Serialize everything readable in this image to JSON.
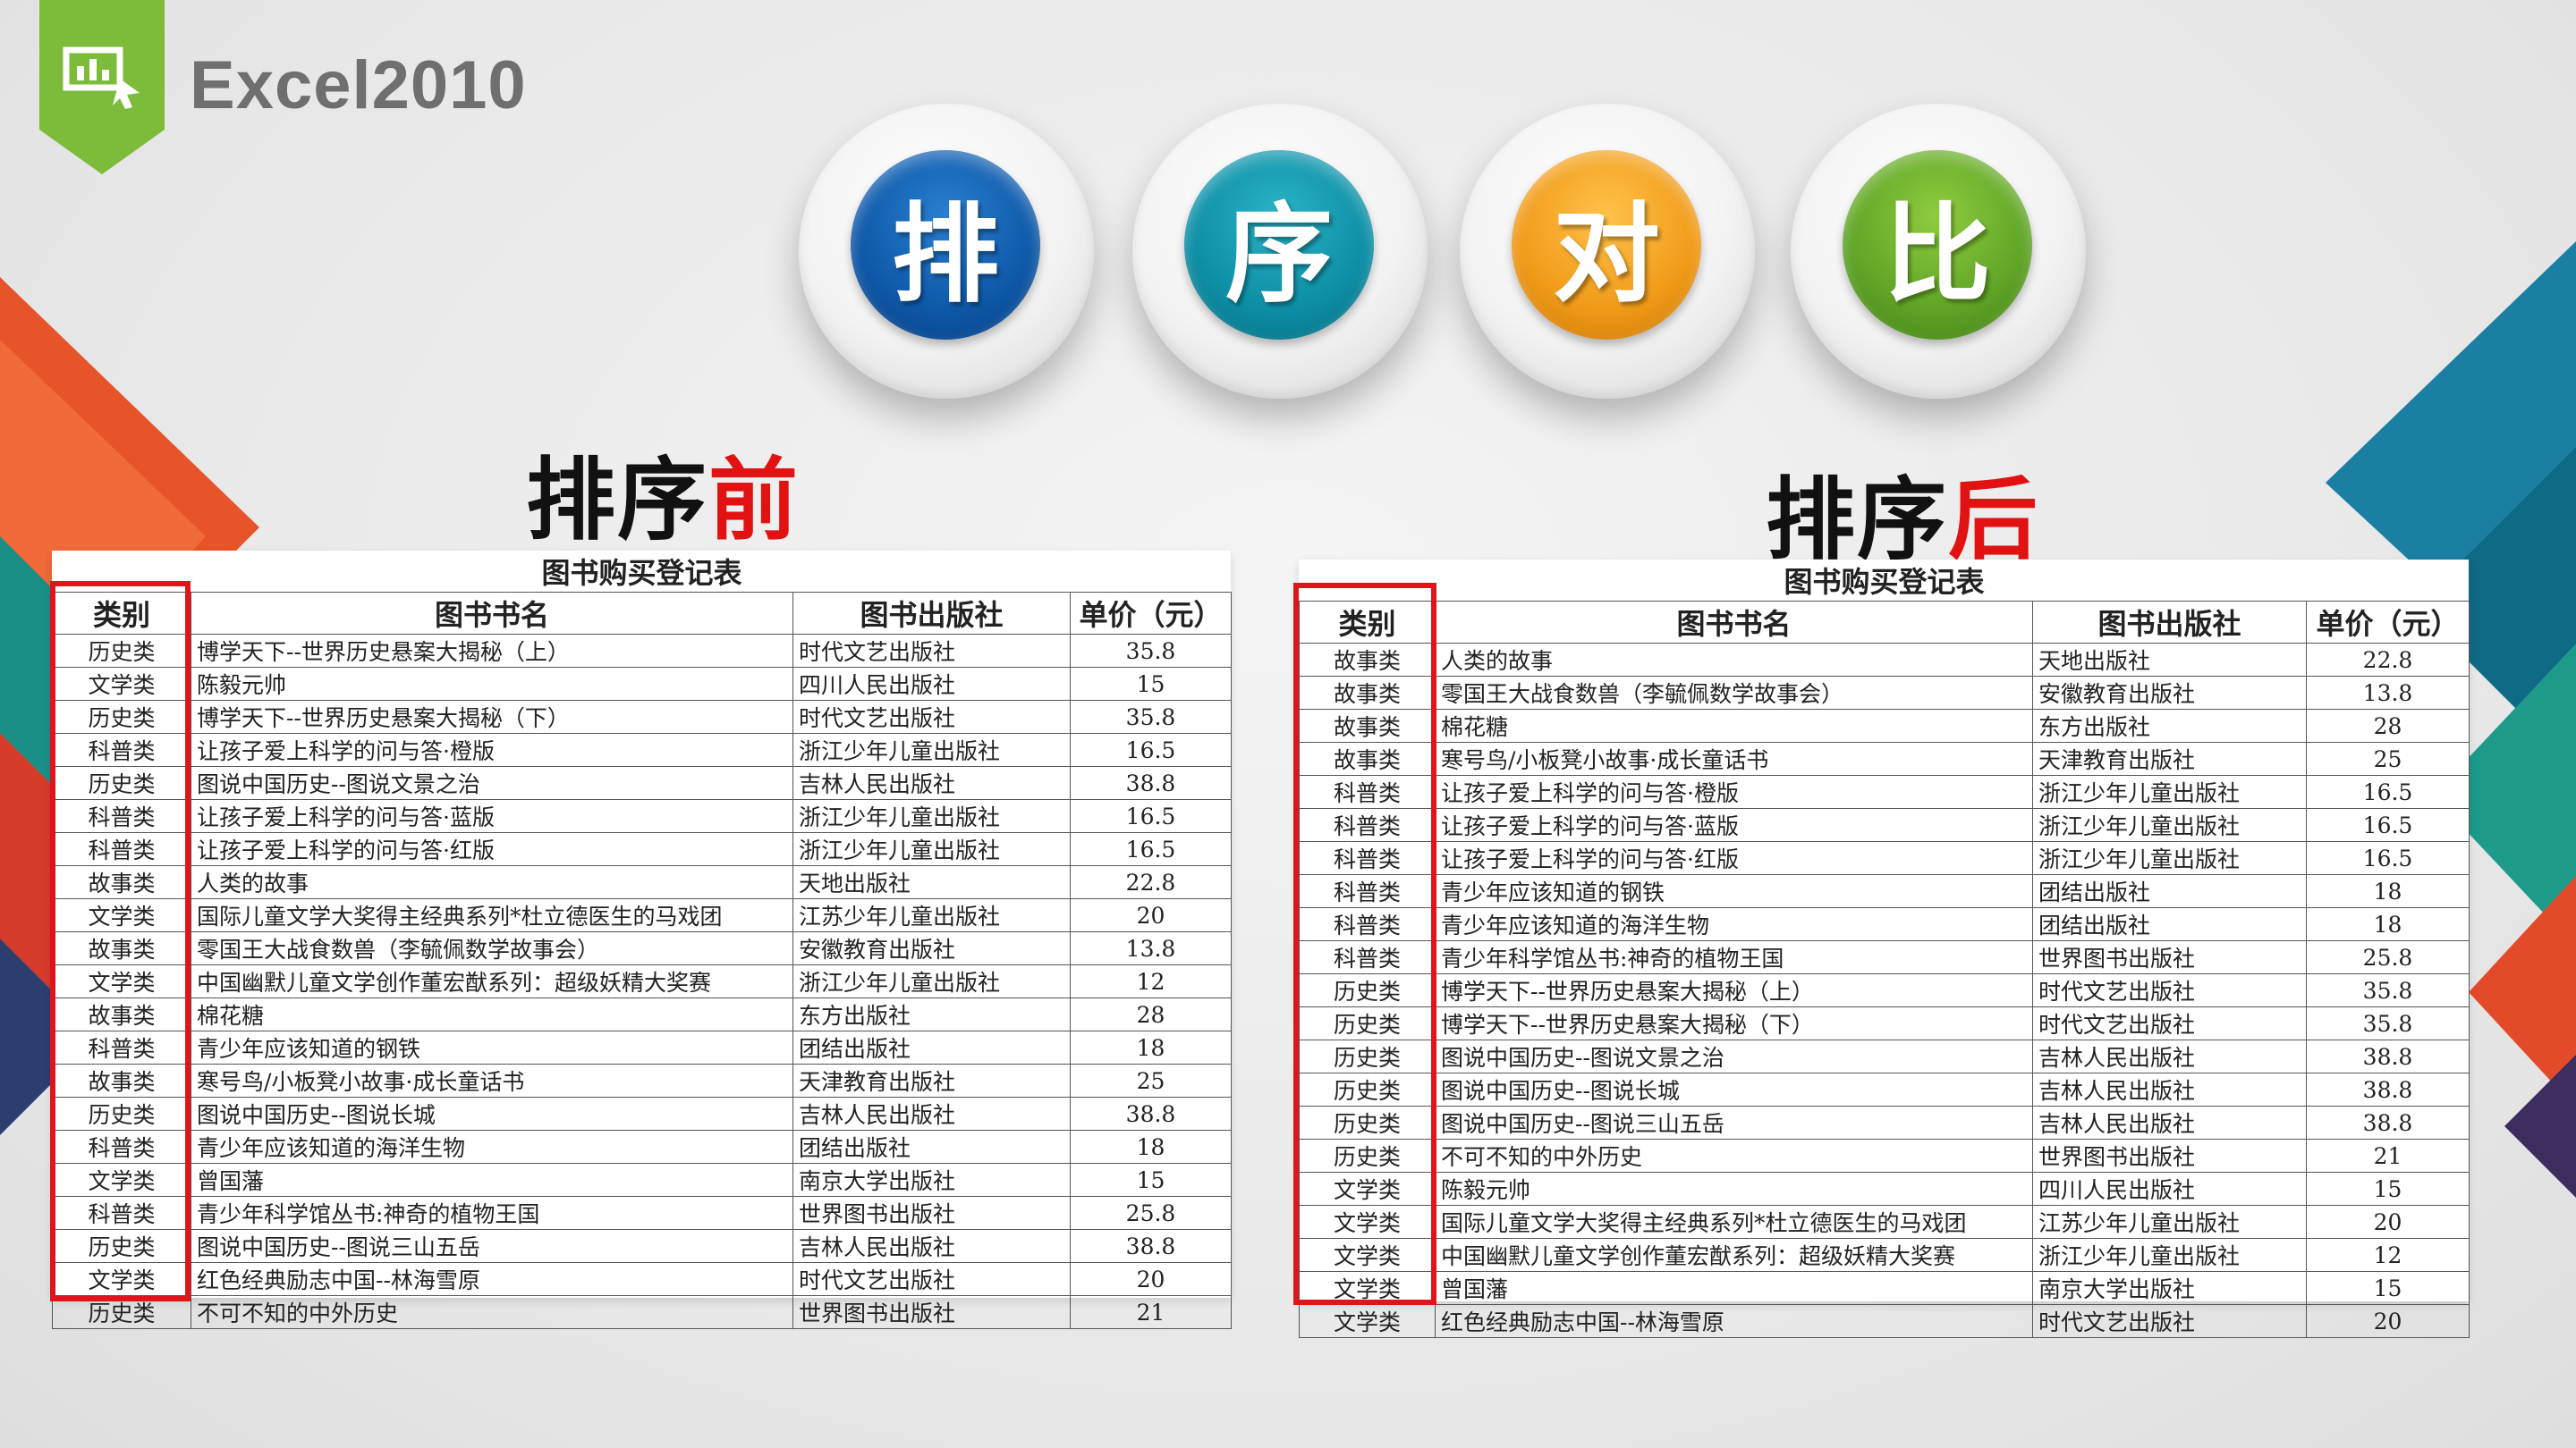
{
  "app": {
    "title": "Excel2010",
    "icon": "chart-icon"
  },
  "circles": [
    {
      "char": "排",
      "color": "#0e58a8"
    },
    {
      "char": "序",
      "color": "#0d8ea5"
    },
    {
      "char": "对",
      "color": "#f09a18"
    },
    {
      "char": "比",
      "color": "#5fa426"
    }
  ],
  "before": {
    "heading_main": "排序",
    "heading_accent": "前",
    "table_title": "图书购买登记表",
    "headers": [
      "类别",
      "图书书名",
      "图书出版社",
      "单价（元）"
    ],
    "rows": [
      [
        "历史类",
        "博学天下--世界历史悬案大揭秘（上）",
        "时代文艺出版社",
        "35.8"
      ],
      [
        "文学类",
        "陈毅元帅",
        "四川人民出版社",
        "15"
      ],
      [
        "历史类",
        "博学天下--世界历史悬案大揭秘（下）",
        "时代文艺出版社",
        "35.8"
      ],
      [
        "科普类",
        "让孩子爱上科学的问与答·橙版",
        "浙江少年儿童出版社",
        "16.5"
      ],
      [
        "历史类",
        "图说中国历史--图说文景之治",
        "吉林人民出版社",
        "38.8"
      ],
      [
        "科普类",
        "让孩子爱上科学的问与答·蓝版",
        "浙江少年儿童出版社",
        "16.5"
      ],
      [
        "科普类",
        "让孩子爱上科学的问与答·红版",
        "浙江少年儿童出版社",
        "16.5"
      ],
      [
        "故事类",
        "人类的故事",
        "天地出版社",
        "22.8"
      ],
      [
        "文学类",
        "国际儿童文学大奖得主经典系列*杜立德医生的马戏团",
        "江苏少年儿童出版社",
        "20"
      ],
      [
        "故事类",
        "零国王大战食数兽（李毓佩数学故事会）",
        "安徽教育出版社",
        "13.8"
      ],
      [
        "文学类",
        "中国幽默儿童文学创作董宏猷系列：超级妖精大奖赛",
        "浙江少年儿童出版社",
        "12"
      ],
      [
        "故事类",
        "棉花糖",
        "东方出版社",
        "28"
      ],
      [
        "科普类",
        "青少年应该知道的钢铁",
        "团结出版社",
        "18"
      ],
      [
        "故事类",
        "寒号鸟/小板凳小故事·成长童话书",
        "天津教育出版社",
        "25"
      ],
      [
        "历史类",
        "图说中国历史--图说长城",
        "吉林人民出版社",
        "38.8"
      ],
      [
        "科普类",
        "青少年应该知道的海洋生物",
        "团结出版社",
        "18"
      ],
      [
        "文学类",
        "曾国藩",
        "南京大学出版社",
        "15"
      ],
      [
        "科普类",
        "青少年科学馆丛书:神奇的植物王国",
        "世界图书出版社",
        "25.8"
      ],
      [
        "历史类",
        "图说中国历史--图说三山五岳",
        "吉林人民出版社",
        "38.8"
      ],
      [
        "文学类",
        "红色经典励志中国--林海雪原",
        "时代文艺出版社",
        "20"
      ],
      [
        "历史类",
        "不可不知的中外历史",
        "世界图书出版社",
        "21"
      ]
    ]
  },
  "after": {
    "heading_main": "排序",
    "heading_accent": "后",
    "table_title": "图书购买登记表",
    "headers": [
      "类别",
      "图书书名",
      "图书出版社",
      "单价（元）"
    ],
    "rows": [
      [
        "故事类",
        "人类的故事",
        "天地出版社",
        "22.8"
      ],
      [
        "故事类",
        "零国王大战食数兽（李毓佩数学故事会）",
        "安徽教育出版社",
        "13.8"
      ],
      [
        "故事类",
        "棉花糖",
        "东方出版社",
        "28"
      ],
      [
        "故事类",
        "寒号鸟/小板凳小故事·成长童话书",
        "天津教育出版社",
        "25"
      ],
      [
        "科普类",
        "让孩子爱上科学的问与答·橙版",
        "浙江少年儿童出版社",
        "16.5"
      ],
      [
        "科普类",
        "让孩子爱上科学的问与答·蓝版",
        "浙江少年儿童出版社",
        "16.5"
      ],
      [
        "科普类",
        "让孩子爱上科学的问与答·红版",
        "浙江少年儿童出版社",
        "16.5"
      ],
      [
        "科普类",
        "青少年应该知道的钢铁",
        "团结出版社",
        "18"
      ],
      [
        "科普类",
        "青少年应该知道的海洋生物",
        "团结出版社",
        "18"
      ],
      [
        "科普类",
        "青少年科学馆丛书:神奇的植物王国",
        "世界图书出版社",
        "25.8"
      ],
      [
        "历史类",
        "博学天下--世界历史悬案大揭秘（上）",
        "时代文艺出版社",
        "35.8"
      ],
      [
        "历史类",
        "博学天下--世界历史悬案大揭秘（下）",
        "时代文艺出版社",
        "35.8"
      ],
      [
        "历史类",
        "图说中国历史--图说文景之治",
        "吉林人民出版社",
        "38.8"
      ],
      [
        "历史类",
        "图说中国历史--图说长城",
        "吉林人民出版社",
        "38.8"
      ],
      [
        "历史类",
        "图说中国历史--图说三山五岳",
        "吉林人民出版社",
        "38.8"
      ],
      [
        "历史类",
        "不可不知的中外历史",
        "世界图书出版社",
        "21"
      ],
      [
        "文学类",
        "陈毅元帅",
        "四川人民出版社",
        "15"
      ],
      [
        "文学类",
        "国际儿童文学大奖得主经典系列*杜立德医生的马戏团",
        "江苏少年儿童出版社",
        "20"
      ],
      [
        "文学类",
        "中国幽默儿童文学创作董宏猷系列：超级妖精大奖赛",
        "浙江少年儿童出版社",
        "12"
      ],
      [
        "文学类",
        "曾国藩",
        "南京大学出版社",
        "15"
      ],
      [
        "文学类",
        "红色经典励志中国--林海雪原",
        "时代文艺出版社",
        "20"
      ]
    ]
  }
}
